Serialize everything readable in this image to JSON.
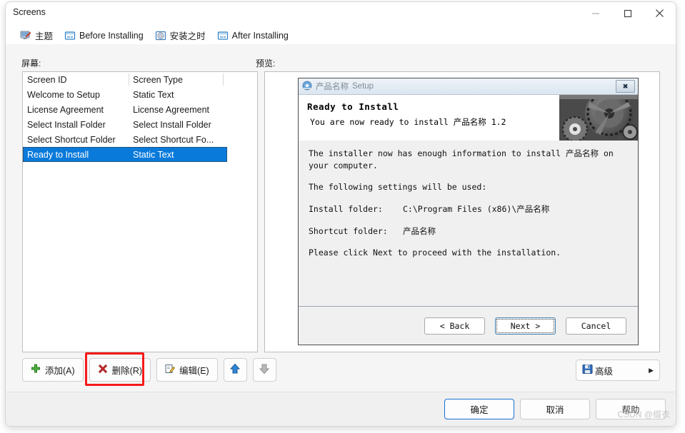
{
  "window": {
    "title": "Screens",
    "controls": {
      "minimize": "minimize-icon",
      "maximize": "maximize-icon",
      "close": "close-icon"
    }
  },
  "tabs": [
    {
      "label": "主题",
      "icon": "theme-icon",
      "active": false
    },
    {
      "label": "Before Installing",
      "icon": "window-icon",
      "active": true
    },
    {
      "label": "安装之时",
      "icon": "disc-icon",
      "active": false
    },
    {
      "label": "After Installing",
      "icon": "window-icon",
      "active": false
    }
  ],
  "labels": {
    "screens": "屏幕:",
    "preview": "预览:"
  },
  "list": {
    "columns": [
      "Screen ID",
      "Screen Type"
    ],
    "rows": [
      {
        "id": "Welcome to Setup",
        "type": "Static Text",
        "selected": false
      },
      {
        "id": "License Agreement",
        "type": "License Agreement",
        "selected": false
      },
      {
        "id": "Select Install Folder",
        "type": "Select Install Folder",
        "selected": false
      },
      {
        "id": "Select Shortcut Folder",
        "type": "Select Shortcut Fo...",
        "selected": false
      },
      {
        "id": "Ready to Install",
        "type": "Static Text",
        "selected": true
      }
    ]
  },
  "toolbar": {
    "add": {
      "label": "添加(A)",
      "icon": "plus-icon"
    },
    "delete": {
      "label": "删除(R)",
      "icon": "red-x-icon",
      "highlighted": true
    },
    "edit": {
      "label": "编辑(E)",
      "icon": "edit-pencil-icon"
    },
    "move_up": {
      "icon": "arrow-up-icon",
      "enabled": true
    },
    "move_down": {
      "icon": "arrow-down-icon",
      "enabled": false
    },
    "advanced": {
      "label": "高级",
      "icon": "floppy-disk-icon",
      "caret": "▶"
    },
    "highlight_color": "#f61a1a"
  },
  "footer": {
    "ok": "确定",
    "cancel": "取消",
    "help": "帮助",
    "watermark": "CSDN @缀衣"
  },
  "preview": {
    "titlebar": {
      "product": "产品名称",
      "suffix": "Setup",
      "close": "close-icon"
    },
    "header": {
      "title": "Ready to Install",
      "subtitle": "You are now ready to install 产品名称 1.2",
      "image": "gears-photo"
    },
    "body": {
      "intro": "The installer now has enough information to install 产品名称 on your computer.",
      "settings_label": "The following settings will be used:",
      "rows": [
        {
          "key": "Install folder:",
          "value": "C:\\Program Files (x86)\\产品名称"
        },
        {
          "key": "Shortcut folder:",
          "value": "产品名称"
        }
      ],
      "outro": "Please click Next to proceed with the installation."
    },
    "buttons": [
      {
        "label": "< Back",
        "focused": false
      },
      {
        "label": "Next >",
        "focused": true
      },
      {
        "label": "Cancel",
        "focused": false
      }
    ]
  },
  "colors": {
    "selection": "#0a7ada",
    "accent": "#1a6fd0",
    "highlight": "#f61a1a"
  }
}
